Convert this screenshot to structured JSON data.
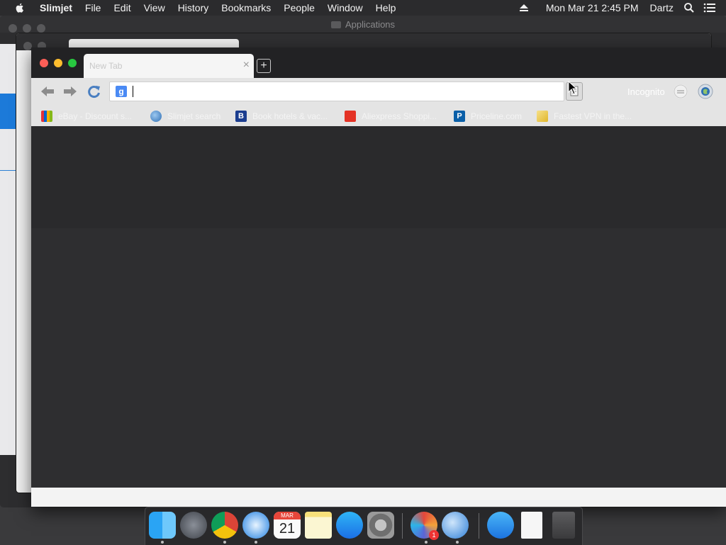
{
  "menubar": {
    "app_name": "Slimjet",
    "items": [
      "File",
      "Edit",
      "View",
      "History",
      "Bookmarks",
      "People",
      "Window",
      "Help"
    ],
    "datetime": "Mon Mar 21  2:45 PM",
    "user": "Dartz"
  },
  "background_window": {
    "title": "Applications"
  },
  "browser": {
    "tab": {
      "title": "New Tab"
    },
    "omnibox": {
      "value": "",
      "search_badge": "g"
    },
    "profile_label": "Incognito",
    "bookmarks": [
      {
        "label": "eBay - Discount s...",
        "icon": "ebay-icon",
        "color": "#e53238"
      },
      {
        "label": "Slimjet search",
        "icon": "globe-icon",
        "color": "#4a90d9"
      },
      {
        "label": "Book hotels & vac...",
        "icon": "booking-icon",
        "color": "#1b3d8f"
      },
      {
        "label": "Aliexpress Shoppi...",
        "icon": "aliexpress-icon",
        "color": "#e43225"
      },
      {
        "label": "Priceline.com",
        "icon": "priceline-icon",
        "color": "#0a5fa8"
      },
      {
        "label": "Fastest VPN in the...",
        "icon": "vpn-icon",
        "color": "#f1c232"
      }
    ]
  },
  "dock": {
    "calendar_month": "MAR",
    "calendar_day": "21",
    "badge_count": "1",
    "apps": [
      "Finder",
      "Launchpad",
      "Chrome",
      "Safari",
      "Calendar",
      "Notes",
      "App Store",
      "System Preferences",
      "Slimjet",
      "Network Radar",
      "App Store Downloads",
      "Document",
      "Trash"
    ]
  }
}
